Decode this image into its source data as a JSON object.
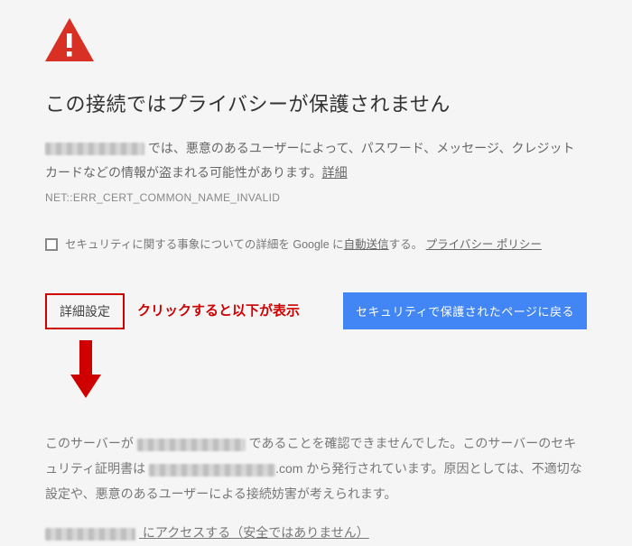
{
  "title": "この接続ではプライバシーが保護されません",
  "desc_part1": " では、悪意のあるユーザーによって、パスワード、メッセージ、クレジット カードなどの情報が盗まれる可能性があります。",
  "learn_more": "詳細",
  "error_code": "NET::ERR_CERT_COMMON_NAME_INVALID",
  "optin_part1": "セキュリティに関する事象についての詳細を Google に",
  "optin_autosend": "自動送信",
  "optin_part2": "する。",
  "privacy_policy": "プライバシー ポリシー",
  "advanced_button": "詳細設定",
  "click_note": "クリックすると以下が表示",
  "back_button": "セキュリティで保護されたページに戻る",
  "detail_part1": "このサーバーが ",
  "detail_part2": " であることを確認できませんでした。このサーバーのセキュリティ証明書は ",
  "detail_domain_suffix": ".com",
  "detail_part3": " から発行されています。原因としては、不適切な設定や、悪意のあるユーザーによる接続妨害が考えられます。",
  "proceed_suffix": " にアクセスする（安全ではありません）"
}
